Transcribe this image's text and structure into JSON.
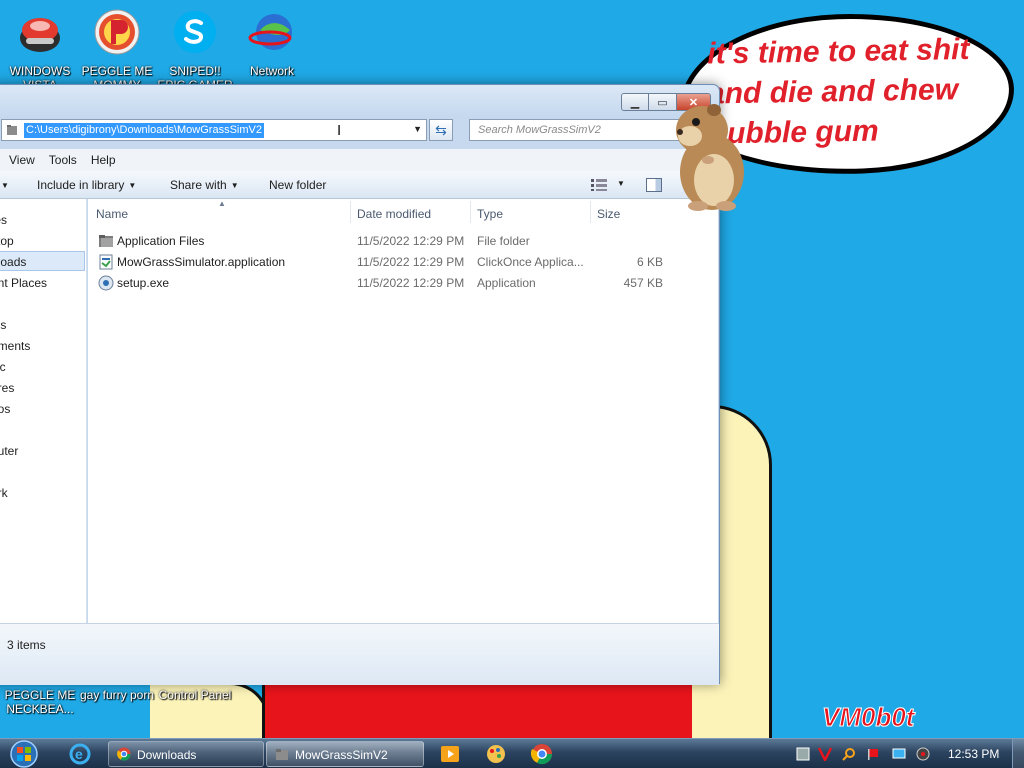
{
  "speech_bubble": {
    "line1": "it's time to eat shit",
    "line2": "and die and chew",
    "line3": "bubble gum"
  },
  "signature": "VM0b0t",
  "desktop_icons": [
    {
      "label": "WINDOWS VISTA",
      "icon": "globe-icon"
    },
    {
      "label": "PEGGLE ME MOMMY",
      "icon": "peggle-icon"
    },
    {
      "label": "SNIPED!! EPIC GAMER 360",
      "icon": "skype-icon"
    },
    {
      "label": "Network",
      "icon": "network-icon"
    },
    {
      "label": "PEGGLE ME NECKBEA...",
      "icon": "peggle-icon"
    },
    {
      "label": "gay furry porn",
      "icon": "folder-icon"
    },
    {
      "label": "Control Panel",
      "icon": "control-panel-icon"
    }
  ],
  "explorer": {
    "address": "C:\\Users\\digibrony\\Downloads\\MowGrassSimV2",
    "search_placeholder": "Search MowGrassSimV2",
    "menu": [
      "View",
      "Tools",
      "Help"
    ],
    "toolbar": {
      "include_in_library": "Include in library",
      "share_with": "Share with",
      "new_folder": "New folder"
    },
    "nav_items": [
      "tes",
      "ktop",
      "nloads",
      "ent Places",
      "ies",
      "uments",
      "sic",
      "ures",
      "eos",
      "outer",
      "ork"
    ],
    "columns": {
      "name": "Name",
      "date": "Date modified",
      "type": "Type",
      "size": "Size"
    },
    "files": [
      {
        "name": "Application Files",
        "date": "11/5/2022 12:29 PM",
        "type": "File folder",
        "size": "",
        "icon": "folder-icon"
      },
      {
        "name": "MowGrassSimulator.application",
        "date": "11/5/2022 12:29 PM",
        "type": "ClickOnce Applica...",
        "size": "6 KB",
        "icon": "application-manifest-icon"
      },
      {
        "name": "setup.exe",
        "date": "11/5/2022 12:29 PM",
        "type": "Application",
        "size": "457 KB",
        "icon": "setup-exe-icon"
      }
    ],
    "status": "3 items"
  },
  "taskbar": {
    "tasks": [
      {
        "label": "Downloads",
        "icon": "chrome-icon"
      },
      {
        "label": "MowGrassSimV2",
        "icon": "folder-icon"
      }
    ],
    "clock": "12:53 PM"
  }
}
